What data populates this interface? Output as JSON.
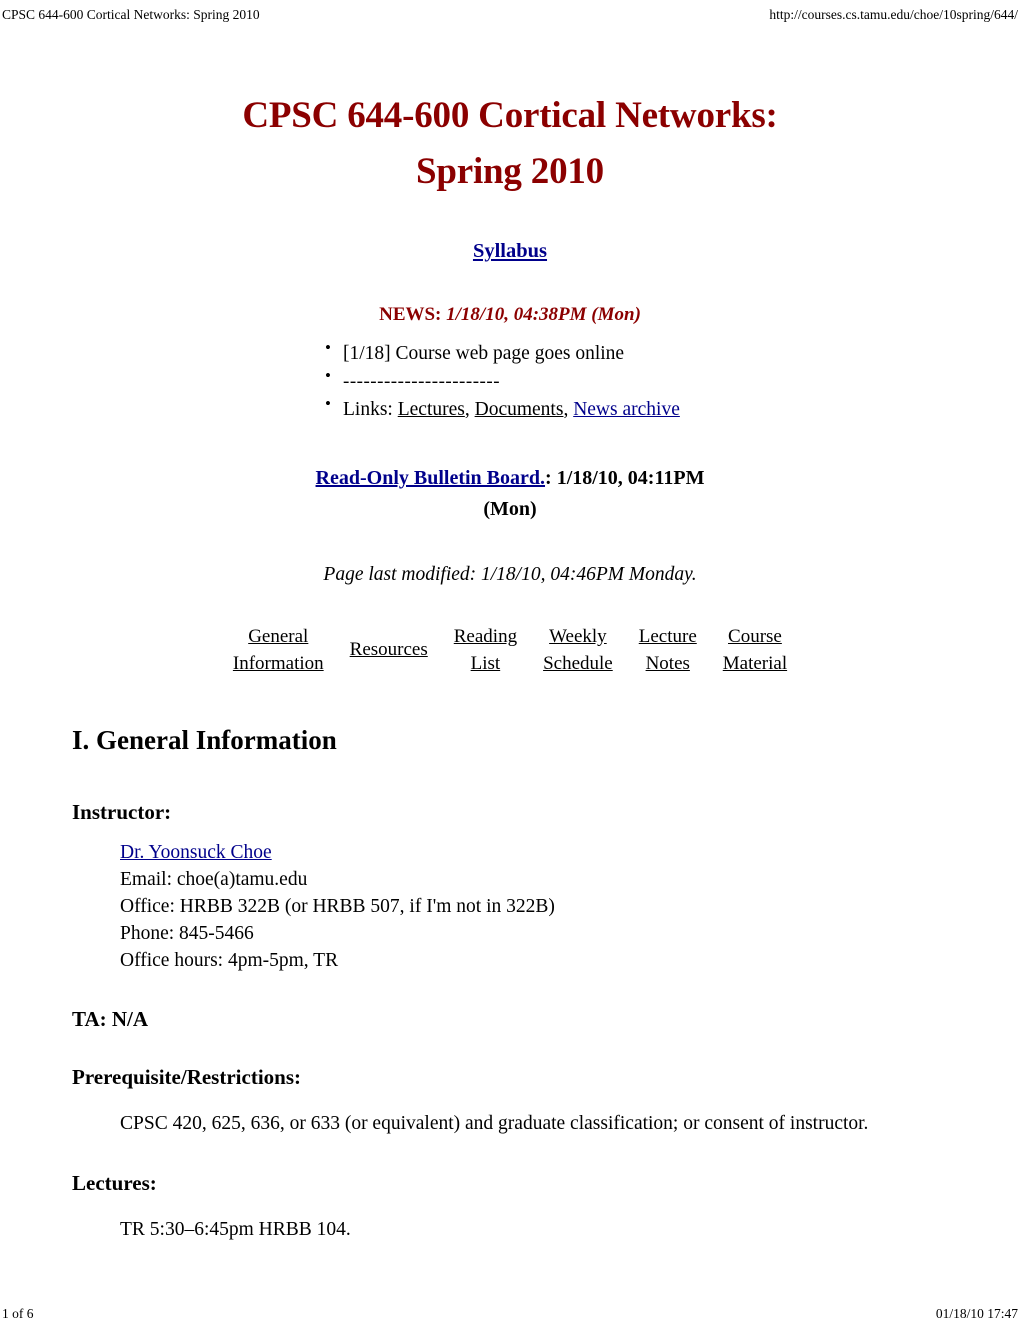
{
  "browser_print": {
    "header_left": "CPSC 644-600 Cortical Networks: Spring 2010",
    "header_right": "http://courses.cs.tamu.edu/choe/10spring/644/",
    "footer_left": "1 of 6",
    "footer_right": "01/18/10 17:47"
  },
  "colors": {
    "title_red": "#8b0000",
    "link_navy": "#00008b",
    "link_visited": "#000000",
    "background": "#ffffff"
  },
  "title": {
    "line1": "CPSC 644-600 Cortical Networks:",
    "line2": "Spring 2010"
  },
  "syllabus": {
    "label": "Syllabus"
  },
  "news": {
    "label": "NEWS:",
    "date": "1/18/10, 04:38PM (Mon)",
    "items": [
      {
        "text": "[1/18] Course web page goes online"
      },
      {
        "text": "-----------------------"
      }
    ],
    "links_line": {
      "prefix": "Links:",
      "link1": "Lectures",
      "sep1": ",",
      "link2": "Documents",
      "sep2": ",",
      "link3": "News archive"
    }
  },
  "bulletin_board": {
    "link_label": "Read-Only Bulletin Board.",
    "separator": ":",
    "time_line1": "1/18/10, 04:11PM",
    "time_line2": "(Mon)"
  },
  "last_modified": "Page last modified: 1/18/10, 04:46PM Monday.",
  "nav": {
    "items": [
      {
        "line1": "General",
        "line2": "Information"
      },
      {
        "line1": "Resources",
        "line2": ""
      },
      {
        "line1": "Reading",
        "line2": "List"
      },
      {
        "line1": "Weekly",
        "line2": "Schedule"
      },
      {
        "line1": "Lecture",
        "line2": "Notes"
      },
      {
        "line1": "Course",
        "line2": "Material"
      }
    ]
  },
  "general_information": {
    "heading": "I. General Information",
    "instructor": {
      "heading": "Instructor:",
      "name": "Dr. Yoonsuck Choe",
      "email": "Email: choe(a)tamu.edu",
      "office": "Office: HRBB 322B (or HRBB 507, if I'm not in 322B)",
      "phone": "Phone: 845-5466",
      "office_hours": "Office hours: 4pm-5pm, TR"
    },
    "ta": {
      "heading": "TA: N/A"
    },
    "prerequisite": {
      "heading": "Prerequisite/Restrictions:",
      "text": "CPSC 420, 625, 636, or 633 (or equivalent) and graduate classification; or consent of instructor."
    },
    "lectures": {
      "heading": "Lectures:",
      "text": "TR 5:30–6:45pm HRBB 104."
    }
  }
}
